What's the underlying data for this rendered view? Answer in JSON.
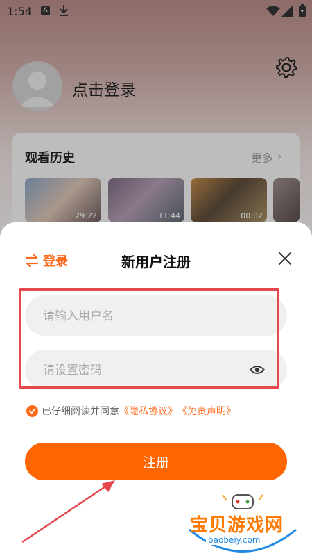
{
  "status_bar": {
    "time": "1:54",
    "icons": [
      "app-a-icon",
      "download-icon",
      "wifi-icon",
      "signal-icon",
      "battery-icon"
    ]
  },
  "profile": {
    "login_prompt": "点击登录"
  },
  "history": {
    "title": "观看历史",
    "more_label": "更多",
    "items": [
      {
        "duration": "29:22"
      },
      {
        "duration": "11:44"
      },
      {
        "duration": "00:02"
      },
      {
        "duration": ""
      }
    ]
  },
  "sheet": {
    "switch_label": "登录",
    "title": "新用户注册",
    "username": {
      "value": "",
      "placeholder": "请输入用户名"
    },
    "password": {
      "value": "",
      "placeholder": "请设置密码"
    },
    "agreement": {
      "prefix": "已仔细阅读并同意",
      "privacy_link": "《隐私协议》",
      "disclaimer_link": "《免责声明》"
    },
    "register_label": "注册"
  },
  "watermark": {
    "main": "宝贝游戏网",
    "url": "baobeiy.com"
  },
  "colors": {
    "accent": "#ff6600",
    "highlight": "#e5484d"
  }
}
